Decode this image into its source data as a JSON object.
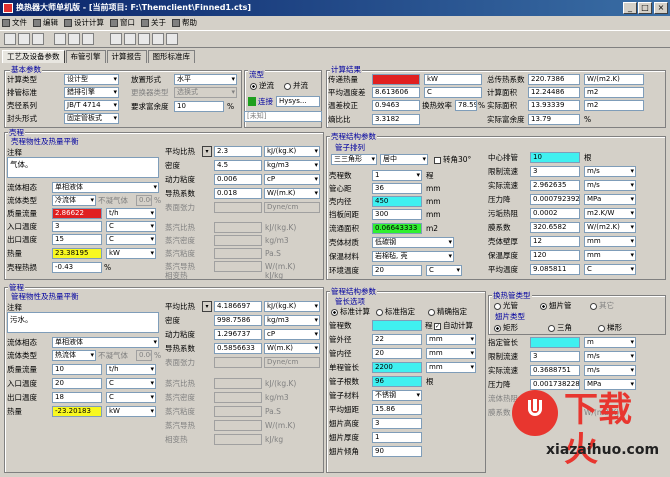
{
  "title": "换热器大师单机版 - [当前项目: F:\\Themclient\\Finned1.cts]",
  "menu": [
    "文件",
    "编辑",
    "设计计算",
    "窗口",
    "关于",
    "帮助"
  ],
  "tabs": [
    "工艺及设备参数",
    "布管引擎",
    "计算报告",
    "图形标准库"
  ],
  "basic": {
    "group": "基本参数",
    "calc_type_l": "计算类型",
    "calc_type": "设计型",
    "layout_l": "排管标准",
    "layout": "錯排引擎",
    "shell_l": "壳径系列",
    "shell": "JB/T 4714",
    "head_l": "封头形式",
    "head": "固定管板式",
    "place_l": "放置形式",
    "place": "水平",
    "replace_l": "更换器类型",
    "replace": "选换式",
    "margin_l": "要求富余度",
    "margin": "10",
    "margin_u": "%"
  },
  "flow": {
    "group": "流型",
    "r1": "逆流",
    "r2": "并流",
    "link": "连接",
    "link_v": "Hysys...",
    "note": "[未知]"
  },
  "calc": {
    "group": "计算结果",
    "q_l": "传递热量",
    "q": "",
    "q_u": "kW",
    "dt_l": "平均温度差",
    "dt": "8.613606",
    "dt_u": "C",
    "tc_l": "温差校正",
    "tc": "0.9463",
    "eff_l": "换热效率",
    "eff": "78.59",
    "eff_u": "%",
    "r_l": "熵比比",
    "r": "3.3182",
    "tq_l": "总传热系数",
    "tq": "220.7386",
    "tq_u": "W/(m2.K)",
    "ca_l": "计算面积",
    "ca": "12.24486",
    "ca_u": "m2",
    "aa_l": "实际面积",
    "aa": "13.93339",
    "aa_u": "m2",
    "am_l": "实际富余度",
    "am": "13.79",
    "am_u": "%"
  },
  "shell": {
    "group": "壳程",
    "sub": "壳程物性及热量平衡",
    "note_l": "注释",
    "note": "气体。",
    "pm_l": "流体相态",
    "pm": "单相液体",
    "ft_l": "流体类型",
    "ft": "冷流体",
    "gas": "不凝气体",
    "gas_v": "0.00",
    "gas_u": "%",
    "mf_l": "质量流量",
    "mf": "2.86622",
    "mf_u": "t/h",
    "ti_l": "入口温度",
    "ti": "3",
    "ti_u": "C",
    "to_l": "出口温度",
    "to": "15",
    "to_u": "C",
    "h_l": "热量",
    "h": "23.38195",
    "h_u": "kW",
    "lh_l": "壳程热损",
    "lh": "-0.43",
    "lh_u": "%",
    "cp_l": "平均比热",
    "cp": "2.3",
    "cp_u": "kJ/(kg.K)",
    "den_l": "密度",
    "den": "4.5",
    "den_u": "kg/m3",
    "vis_l": "动力粘度",
    "vis": "0.006",
    "vis_u": "cP",
    "k_l": "导热系数",
    "k": "0.018",
    "k_u": "W/(m.K)",
    "st_l": "表面张力",
    "st_u": "Dyne/cm",
    "g_cp_l": "蒸汽比热",
    "g_cp_u": "kJ/(kg.K)",
    "g_den_l": "蒸汽密度",
    "g_den_u": "kg/m3",
    "g_vis_l": "蒸汽粘度",
    "g_vis_u": "Pa.S",
    "g_k_l": "蒸汽导热",
    "g_k_u": "W/(m.K)",
    "lat_l": "相变热",
    "lat_u": "kJ/kg"
  },
  "struct": {
    "group": "壳程结构参数",
    "sub": "管子排列",
    "arr": "三三角形",
    "pos": "居中",
    "rot": "转角30°",
    "sn_l": "壳程数",
    "sn": "1",
    "sn_u": "程",
    "nd_l": "管心距",
    "nd": "36",
    "nd_u": "mm",
    "id_l": "壳内径",
    "id": "450",
    "id_u": "mm",
    "bs_l": "挡板间距",
    "bs": "300",
    "bs_u": "mm",
    "fa_l": "流通面积",
    "fa": "0.06643333",
    "fa_u": "m2",
    "mat_l": "壳体材质",
    "mat": "低碳钢",
    "ins_l": "保温材料",
    "ins": "岩棉毡, 壳",
    "et_l": "环境温度",
    "et": "20",
    "et_u": "C",
    "cn_l": "中心排管",
    "cn": "10",
    "cn_u": "根",
    "lf_l": "限制流速",
    "lf": "3",
    "lf_u": "m/s",
    "af_l": "实际流速",
    "af": "2.962635",
    "af_u": "m/s",
    "dp_l": "压力降",
    "dp": "0.000792392",
    "dp_u": "MPa",
    "fr_l": "污垢热阻",
    "fr": "0.0002",
    "fr_u": "m2.K/W",
    "fc_l": "膜系数",
    "fc": "320.6582",
    "fc_u": "W/(m2.K)",
    "st_l": "壳体壁厚",
    "st": "12",
    "st_u": "mm",
    "it_l": "保温厚度",
    "it": "120",
    "it_u": "mm",
    "ps_l": "平均温度",
    "ps": "9.085811",
    "ps_u": "C"
  },
  "tube": {
    "group": "管程",
    "sub": "管程物性及热量平衡",
    "note_l": "注释",
    "note": "污水。",
    "pm_l": "流体相态",
    "pm": "单相液体",
    "ft_l": "流体类型",
    "ft": "热流体",
    "gas": "不凝气体",
    "gas_v": "0.00",
    "gas_u": "%",
    "mf_l": "质量流量",
    "mf": "10",
    "mf_u": "t/h",
    "ti_l": "入口温度",
    "ti": "20",
    "ti_u": "C",
    "to_l": "出口温度",
    "to": "18",
    "to_u": "C",
    "h_l": "热量",
    "h": "-23.20183",
    "h_u": "kW",
    "cp_l": "平均比热",
    "cp": "4.186697",
    "cp_u": "kJ/(kg.K)",
    "den_l": "密度",
    "den": "998.7586",
    "den_u": "kg/m3",
    "vis_l": "动力粘度",
    "vis": "1.296737",
    "vis_u": "cP",
    "k_l": "导热系数",
    "k": "0.5856633",
    "k_u": "W(m.K)",
    "st_l": "表面张力",
    "st_u": "Dyne/cm",
    "g_cp_l": "蒸汽比热",
    "g_cp_u": "kJ/(kg.K)",
    "g_den_l": "蒸汽密度",
    "g_den_u": "kg/m3",
    "g_vis_l": "蒸汽粘度",
    "g_vis_u": "Pa.S",
    "g_k_l": "蒸汽导热",
    "g_k_u": "W/(m.K)",
    "lat_l": "相变热",
    "lat_u": "kJ/kg"
  },
  "tstruct": {
    "group": "管程结构参数",
    "sub": "管长选项",
    "r1": "标准计算",
    "r2": "标准指定",
    "r3": "精确指定",
    "n_l": "管程数",
    "n": "",
    "n_u": "程",
    "auto": "自动计算",
    "od_l": "管外径",
    "od": "22",
    "od_u": "mm",
    "idd_l": "管内径",
    "idd": "20",
    "idd_u": "mm",
    "ul_l": "单程管长",
    "ul": "2200",
    "ul_u": "mm",
    "tn_l": "管子根数",
    "tn": "96",
    "tn_u": "根",
    "mat_l": "管子材料",
    "mat": "不锈钢",
    "mt_l": "平均翅距",
    "mt": "15.86",
    "fh_l": "翅片高度",
    "fh": "3",
    "fw_l": "翅片厚度",
    "fw": "1",
    "fa_l": "翅片倾角",
    "fa": "90"
  },
  "hx": {
    "group": "换热管类型",
    "r1": "光管",
    "r2": "翅片管",
    "r3": "其它",
    "sub": "翅片类型",
    "f1": "矩形",
    "f2": "三角",
    "f3": "梯形",
    "pt_l": "指定管长",
    "pt": "",
    "pt_u": "m",
    "lf_l": "限制流速",
    "lf": "3",
    "lf_u": "m/s",
    "af_l": "实际流速",
    "af": "0.3688751",
    "af_u": "m/s",
    "dp_l": "压力降",
    "dp": "0.001738228",
    "dp_u": "MPa",
    "fr_l": "流体热阻",
    "fc_l": "膜系数",
    "fc_u": "W/(m2.K)"
  },
  "watermark": {
    "logo": "下载火",
    "url": "xiazaihuo.com"
  }
}
